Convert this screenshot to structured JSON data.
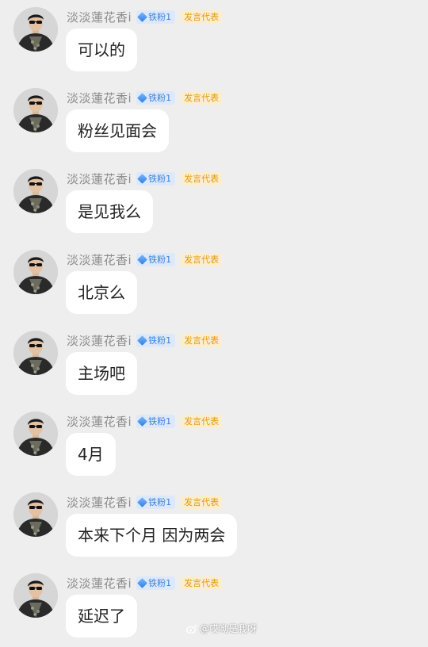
{
  "messages": [
    {
      "user": "淡淡蓮花香i",
      "fan_level": "铁粉1",
      "role": "发言代表",
      "text": "可以的"
    },
    {
      "user": "淡淡蓮花香i",
      "fan_level": "铁粉1",
      "role": "发言代表",
      "text": "粉丝见面会"
    },
    {
      "user": "淡淡蓮花香i",
      "fan_level": "铁粉1",
      "role": "发言代表",
      "text": "是见我么"
    },
    {
      "user": "淡淡蓮花香i",
      "fan_level": "铁粉1",
      "role": "发言代表",
      "text": "北京么"
    },
    {
      "user": "淡淡蓮花香i",
      "fan_level": "铁粉1",
      "role": "发言代表",
      "text": "主场吧"
    },
    {
      "user": "淡淡蓮花香i",
      "fan_level": "铁粉1",
      "role": "发言代表",
      "text": "4月"
    },
    {
      "user": "淡淡蓮花香i",
      "fan_level": "铁粉1",
      "role": "发言代表",
      "text": "本来下个月 因为两会"
    },
    {
      "user": "淡淡蓮花香i",
      "fan_level": "铁粉1",
      "role": "发言代表",
      "text": "延迟了"
    }
  ],
  "watermark": "@哎呦是我呀",
  "icons": {
    "avatar": "user-avatar",
    "fan_badge": "diamond-icon",
    "watermark_logo": "weibo-logo"
  },
  "colors": {
    "background": "#eeeeee",
    "bubble": "#ffffff",
    "username": "#8c8c8c",
    "fan_badge_bg": "#dde9fa",
    "fan_badge_text": "#3b82d6",
    "role_badge_bg": "#fbeecf",
    "role_badge_text": "#e39a12"
  }
}
